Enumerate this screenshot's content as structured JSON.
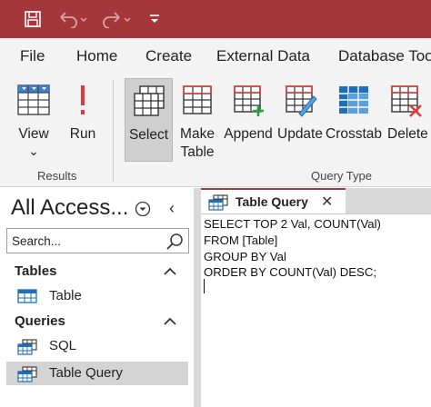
{
  "quick_access": {
    "icons": [
      "save-icon",
      "undo-icon",
      "redo-icon",
      "customize-qat-icon"
    ]
  },
  "ribbon_tabs": [
    "File",
    "Home",
    "Create",
    "External Data",
    "Database Too"
  ],
  "ribbon": {
    "results_group": {
      "label": "Results",
      "view_label": "View",
      "view_dropdown": "⌄",
      "run_label": "Run"
    },
    "query_type_group": {
      "label": "Query Type",
      "select_label": "Select",
      "make_table_line1": "Make",
      "make_table_line2": "Table",
      "append_label": "Append",
      "update_label": "Update",
      "crosstab_label": "Crosstab",
      "delete_label": "Delete"
    }
  },
  "navigation": {
    "title": "All Access...",
    "collapse_glyph": "‹",
    "search_placeholder": "Search...",
    "sections": [
      {
        "label": "Tables",
        "items": [
          "Table"
        ]
      },
      {
        "label": "Queries",
        "items": [
          "SQL",
          "Table Query"
        ]
      }
    ]
  },
  "document": {
    "tab_label": "Table Query",
    "close_glyph": "✕",
    "sql_lines": [
      "SELECT TOP 2 Val, COUNT(Val)",
      "FROM [Table]",
      "GROUP BY Val",
      "ORDER BY COUNT(Val) DESC;"
    ]
  },
  "colors": {
    "accent": "#a4373a",
    "ribbon_bg": "#f3f3f3",
    "selected_bg": "#cfcfcf",
    "grid_blue": "#1e6fb8"
  }
}
